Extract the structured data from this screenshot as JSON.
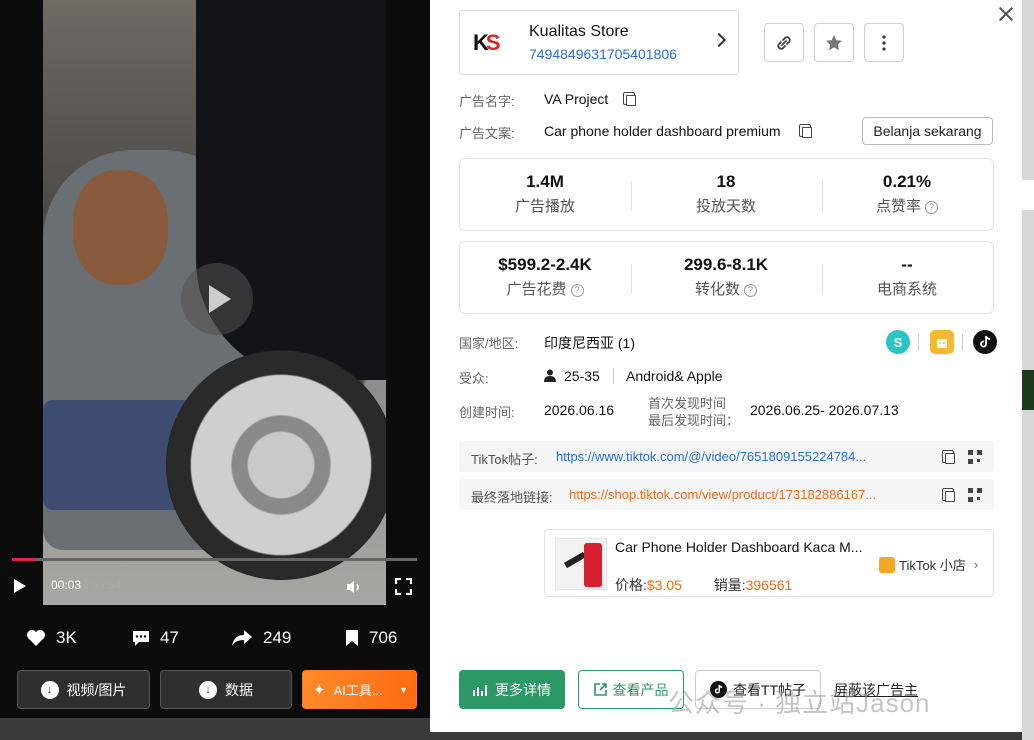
{
  "video": {
    "current_time": "00:03",
    "duration": "00:54",
    "separator": " / ",
    "progress_fraction": 0.06
  },
  "engagement": {
    "likes": "3K",
    "comments": "47",
    "shares": "249",
    "saves": "706"
  },
  "left_buttons": {
    "media": "视频/图片",
    "data": "数据",
    "ai": "AI工具..."
  },
  "store": {
    "logo_k": "K",
    "logo_s": "S",
    "name": "Kualitas Store",
    "id": "7494849631705401806"
  },
  "ad": {
    "name_label": "广告名字:",
    "name": "VA Project",
    "copy_label": "广告文案:",
    "copy": "Car phone holder dashboard premium",
    "shop_button": "Belanja sekarang"
  },
  "metrics_top": [
    {
      "value": "1.4M",
      "label": "广告播放"
    },
    {
      "value": "18",
      "label": "投放天数"
    },
    {
      "value": "0.21%",
      "label": "点赞率"
    }
  ],
  "metrics_bottom": [
    {
      "value": "$599.2-2.4K",
      "label": "广告花费"
    },
    {
      "value": "299.6-8.1K",
      "label": "转化数"
    },
    {
      "value": "--",
      "label": "电商系统"
    }
  ],
  "info": {
    "country_label": "国家/地区:",
    "country": "印度尼西亚 (1)",
    "audience_label": "受众:",
    "age": "25-35",
    "platform": "Android& Apple",
    "created_label": "创建时间:",
    "created": "2026.06.16",
    "first_seen_label": "首次发现时间",
    "last_seen_label": "最后发现时间：",
    "seen_range": "2026.06.25- 2026.07.13"
  },
  "social": {
    "s_letter": "S"
  },
  "links": {
    "tiktok_label": "TikTok帖子:",
    "tiktok_url": "https://www.tiktok.com/@/video/7651809155224784...",
    "landing_label": "最终落地链接:",
    "landing_url": "https://shop.tiktok.com/view/product/173182886167..."
  },
  "product": {
    "title": "Car Phone Holder Dashboard Kaca M...",
    "price_label": "价格:",
    "price": "$3.05",
    "sales_label": "销量:",
    "sales": "396561",
    "shop": "TikTok 小店"
  },
  "actions": {
    "more": "更多详情",
    "view_product": "查看产品",
    "view_tt": "查看TT帖子",
    "block": "屏蔽该广告主"
  },
  "watermark": "公众号 · 独立站Jason",
  "colors": {
    "accent_green": "#2c9866",
    "link_blue": "#2a6fd6",
    "link_orange": "#f36b12",
    "ai_orange": "#ff7a1a"
  }
}
